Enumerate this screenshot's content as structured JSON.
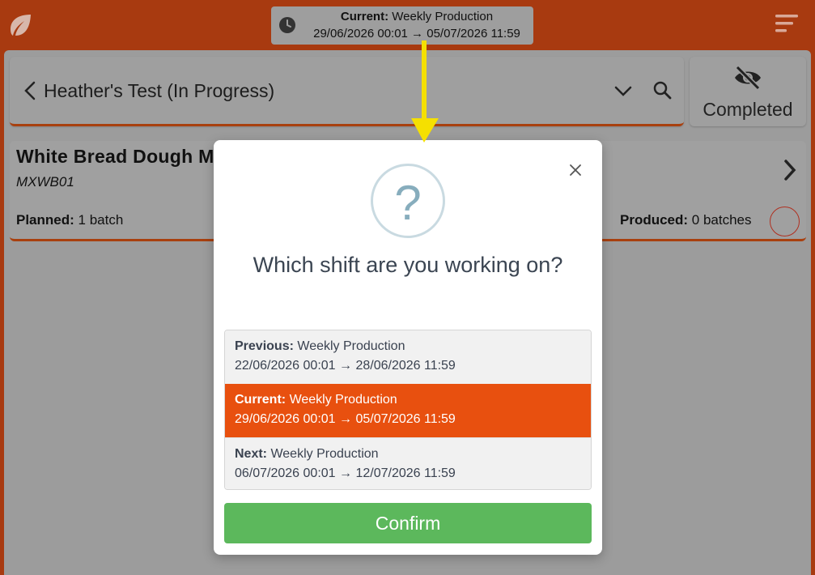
{
  "topbar": {
    "shift_label_prefix": "Current:",
    "shift_name": "Weekly Production",
    "shift_range": "29/06/2026 00:01 → 05/07/2026 11:59"
  },
  "search": {
    "title": "Heather's Test (In Progress)"
  },
  "completed_toggle": {
    "label": "Completed"
  },
  "item": {
    "name": "White Bread Dough M",
    "code": "MXWB01",
    "planned_label": "Planned:",
    "planned_value": "1 batch",
    "produced_label": "Produced:",
    "produced_value": "0 batches"
  },
  "modal": {
    "question": "Which shift are you working on?",
    "options": [
      {
        "prefix": "Previous:",
        "name": "Weekly Production",
        "range": "22/06/2026 00:01 → 28/06/2026 11:59",
        "selected": false
      },
      {
        "prefix": "Current:",
        "name": "Weekly Production",
        "range": "29/06/2026 00:01 → 05/07/2026 11:59",
        "selected": true
      },
      {
        "prefix": "Next:",
        "name": "Weekly Production",
        "range": "06/07/2026 00:01 → 12/07/2026 11:59",
        "selected": false
      }
    ],
    "confirm_label": "Confirm"
  },
  "colors": {
    "brand": "#a83a10",
    "selected": "#e8500f",
    "confirm": "#5cb85c",
    "annotation": "#f5e000"
  },
  "icons": [
    "leaf-logo-icon",
    "clock-icon",
    "menu-icon",
    "chevron-left-icon",
    "chevron-down-icon",
    "search-icon",
    "eye-slash-icon",
    "chevron-right-icon",
    "close-icon",
    "question-icon"
  ]
}
